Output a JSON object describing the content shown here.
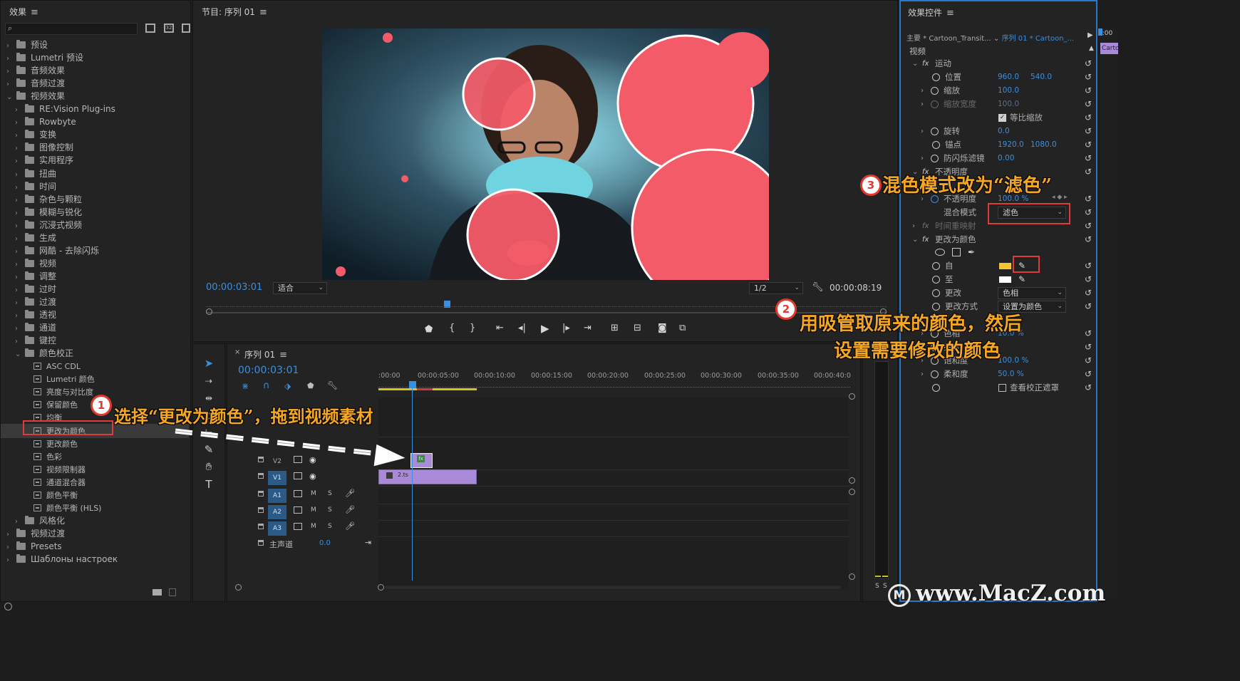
{
  "effects_panel": {
    "title": "效果",
    "items": [
      {
        "label": "预设",
        "depth": 0,
        "icon": "preset-folder-icon"
      },
      {
        "label": "Lumetri 预设",
        "depth": 0,
        "icon": "preset-folder-icon"
      },
      {
        "label": "音频效果",
        "depth": 0,
        "icon": "folder-icon"
      },
      {
        "label": "音频过渡",
        "depth": 0,
        "icon": "folder-icon"
      },
      {
        "label": "视频效果",
        "depth": 0,
        "icon": "folder-icon",
        "open": true
      },
      {
        "label": "RE:Vision Plug-ins",
        "depth": 1,
        "icon": "folder-icon"
      },
      {
        "label": "Rowbyte",
        "depth": 1,
        "icon": "folder-icon"
      },
      {
        "label": "变换",
        "depth": 1,
        "icon": "folder-icon"
      },
      {
        "label": "图像控制",
        "depth": 1,
        "icon": "folder-icon"
      },
      {
        "label": "实用程序",
        "depth": 1,
        "icon": "folder-icon"
      },
      {
        "label": "扭曲",
        "depth": 1,
        "icon": "folder-icon"
      },
      {
        "label": "时间",
        "depth": 1,
        "icon": "folder-icon"
      },
      {
        "label": "杂色与颗粒",
        "depth": 1,
        "icon": "folder-icon"
      },
      {
        "label": "模糊与锐化",
        "depth": 1,
        "icon": "folder-icon"
      },
      {
        "label": "沉浸式视频",
        "depth": 1,
        "icon": "folder-icon"
      },
      {
        "label": "生成",
        "depth": 1,
        "icon": "folder-icon"
      },
      {
        "label": "网酷 - 去除闪烁",
        "depth": 1,
        "icon": "folder-icon"
      },
      {
        "label": "视频",
        "depth": 1,
        "icon": "folder-icon"
      },
      {
        "label": "调整",
        "depth": 1,
        "icon": "folder-icon"
      },
      {
        "label": "过时",
        "depth": 1,
        "icon": "folder-icon"
      },
      {
        "label": "过渡",
        "depth": 1,
        "icon": "folder-icon"
      },
      {
        "label": "透视",
        "depth": 1,
        "icon": "folder-icon"
      },
      {
        "label": "通道",
        "depth": 1,
        "icon": "folder-icon"
      },
      {
        "label": "键控",
        "depth": 1,
        "icon": "folder-icon"
      },
      {
        "label": "颜色校正",
        "depth": 1,
        "icon": "folder-icon",
        "open": true
      },
      {
        "label": "ASC CDL",
        "depth": 2,
        "icon": "effect-icon"
      },
      {
        "label": "Lumetri 颜色",
        "depth": 2,
        "icon": "effect-icon"
      },
      {
        "label": "亮度与对比度",
        "depth": 2,
        "icon": "effect-icon"
      },
      {
        "label": "保留颜色",
        "depth": 2,
        "icon": "effect-icon"
      },
      {
        "label": "均衡",
        "depth": 2,
        "icon": "effect-icon"
      },
      {
        "label": "更改为颜色",
        "depth": 2,
        "icon": "effect-icon",
        "selected": true
      },
      {
        "label": "更改颜色",
        "depth": 2,
        "icon": "effect-icon"
      },
      {
        "label": "色彩",
        "depth": 2,
        "icon": "effect-icon"
      },
      {
        "label": "视频限制器",
        "depth": 2,
        "icon": "effect-icon"
      },
      {
        "label": "通道混合器",
        "depth": 2,
        "icon": "effect-icon"
      },
      {
        "label": "颜色平衡",
        "depth": 2,
        "icon": "effect-icon"
      },
      {
        "label": "颜色平衡 (HLS)",
        "depth": 2,
        "icon": "effect-icon"
      },
      {
        "label": "风格化",
        "depth": 1,
        "icon": "folder-icon"
      },
      {
        "label": "视频过渡",
        "depth": 0,
        "icon": "folder-icon"
      },
      {
        "label": "Presets",
        "depth": 0,
        "icon": "preset-folder-icon"
      },
      {
        "label": "Шаблоны настроек",
        "depth": 0,
        "icon": "preset-folder-icon"
      }
    ]
  },
  "program_monitor": {
    "title": "节目: 序列 01",
    "timecode": "00:00:03:01",
    "fit_label": "适合",
    "resolution": "1/2",
    "duration": "00:00:08:19",
    "playhead_fraction": 0.35
  },
  "effect_controls": {
    "title": "效果控件",
    "master_label": "主要 * Cartoon_Transit...",
    "sequence_label": "序列 01 * Cartoon_...",
    "ruler_time": "0:00",
    "clip_chip": "Carto",
    "section_video": "视频",
    "motion": {
      "label": "运动",
      "position_label": "位置",
      "position_x": "960.0",
      "position_y": "540.0",
      "scale_label": "缩放",
      "scale": "100.0",
      "scale_width_label": "缩放宽度",
      "scale_width": "100.0",
      "uniform_label": "等比缩放",
      "rotation_label": "旋转",
      "rotation": "0.0",
      "anchor_label": "锚点",
      "anchor_x": "1920.0",
      "anchor_y": "1080.0",
      "antiflicker_label": "防闪烁滤镜",
      "antiflicker": "0.00"
    },
    "opacity": {
      "label": "不透明度",
      "opacity_label": "不透明度",
      "opacity": "100.0 %",
      "blend_label": "混合模式",
      "blend_value": "滤色"
    },
    "time_remap_label": "时间重映射",
    "change_to_color": {
      "label": "更改为颜色",
      "from_label": "自",
      "from_color": "#f6c531",
      "to_label": "至",
      "to_color": "#ffffff",
      "change_label": "更改",
      "change_value": "色相",
      "change_by_label": "更改方式",
      "change_by_value": "设置为颜色",
      "hue_label": "色相",
      "hue": "10.0 %",
      "brightness_label": "亮度",
      "brightness": "",
      "saturation_label": "饱和度",
      "saturation": "100.0 %",
      "softness_label": "柔和度",
      "softness": "50.0 %",
      "view_mask_label": "查看校正遮罩"
    }
  },
  "timeline": {
    "title": "序列 01",
    "timecode": "00:00:03:01",
    "ruler": [
      ":00:00",
      "00:00:05:00",
      "00:00:10:00",
      "00:00:15:00",
      "00:00:20:00",
      "00:00:25:00",
      "00:00:30:00",
      "00:00:35:00",
      "00:00:40:0"
    ],
    "tracks": [
      {
        "name": "V2",
        "kind": "video",
        "badge": "V2"
      },
      {
        "name": "V1",
        "kind": "video",
        "badge": "V1"
      },
      {
        "name": "A1",
        "kind": "audio",
        "badge": "A1"
      },
      {
        "name": "A2",
        "kind": "audio",
        "badge": "A2"
      },
      {
        "name": "A3",
        "kind": "audio",
        "badge": "A3"
      }
    ],
    "master_label": "主声道",
    "master_value": "0.0",
    "clip_v1_label": "2.ts",
    "clip_v2_label": "fx"
  },
  "meters": {
    "solo_left": "S",
    "solo_right": "S"
  },
  "annotations": {
    "step1_num": "1",
    "step1_text": "选择“更改为颜色”，拖到视频素材",
    "step2_num": "2",
    "step2_line1": "用吸管取原来的颜色，然后",
    "step2_line2": "设置需要修改的颜色",
    "step3_num": "3",
    "step3_text": "混色模式改为“滤色”"
  },
  "watermark": "www.MacZ.com",
  "colors": {
    "accent_blue": "#3b8fe0",
    "annotation_orange": "#f5a623",
    "annotation_red": "#e03a2e",
    "clip_purple": "#a98ad8"
  }
}
